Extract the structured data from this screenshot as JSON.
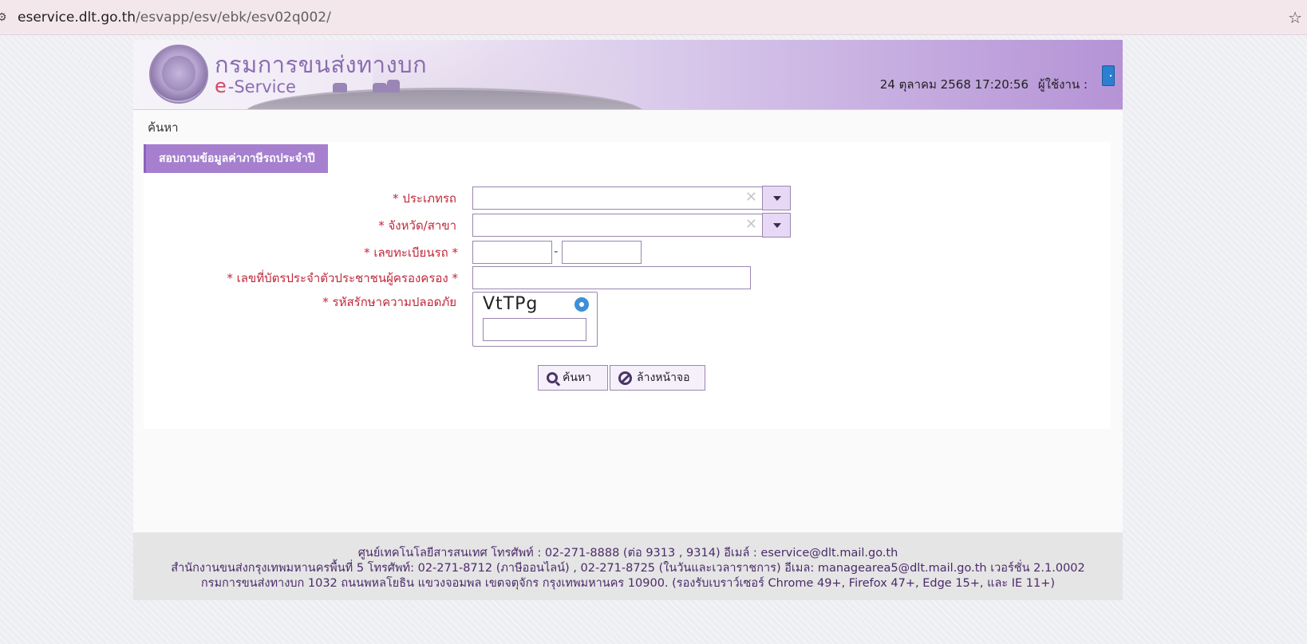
{
  "browser": {
    "url_host": "eservice.dlt.go.th",
    "url_path": "/esvapp/esv/ebk/esv02q002/",
    "site_icon": "site-settings-icon",
    "bookmark_icon": "star-icon"
  },
  "header": {
    "dept_name": "กรมการขนส่งทางบก",
    "service_e": "e",
    "service_rest": "-Service",
    "datetime": "24 ตุลาคม 2568 17:20:56",
    "user_label": "ผู้ใช้งาน :",
    "logout_icon": "door-icon"
  },
  "breadcrumb": "ค้นหา",
  "panel": {
    "title": "สอบถามข้อมูลค่าภาษีรถประจำปี"
  },
  "form": {
    "vehicle_type_label": "* ประเภทรถ",
    "province_label": "* จังหวัด/สาขา",
    "plate_label": "* เลขทะเบียนรถ *",
    "plate_separator": "-",
    "id_card_label": "* เลขที่บัตรประจำตัวประชาชนผู้ครองครอง *",
    "captcha_label": "* รหัสรักษาความปลอดภัย",
    "captcha_text": "VtTPg",
    "clear_glyph": "✕"
  },
  "buttons": {
    "search": "ค้นหา",
    "reset": "ล้างหน้าจอ"
  },
  "footer": {
    "line1": "ศูนย์เทคโนโลยีสารสนเทศ โทรศัพท์ : 02-271-8888 (ต่อ 9313 , 9314) อีเมล์ : eservice@dlt.mail.go.th",
    "line2": "สำนักงานขนส่งกรุงเทพมหานครพื้นที่ 5 โทรศัพท์: 02-271-8712 (ภาษีออนไลน์) , 02-271-8725 (ในวันและเวลาราชการ) อีเมล: managearea5@dlt.mail.go.th เวอร์ชั่น 2.1.0002",
    "line3": "กรมการขนส่งทางบก 1032 ถนนพหลโยธิน แขวงจอมพล เขตจตุจักร กรุงเทพมหานคร 10900. (รองรับเบราว์เซอร์ Chrome 49+, Firefox 47+, Edge 15+, และ IE 11+)"
  },
  "colors": {
    "accent": "#a680cf",
    "required": "#c0283a",
    "footer_text": "#4b2a6a"
  }
}
